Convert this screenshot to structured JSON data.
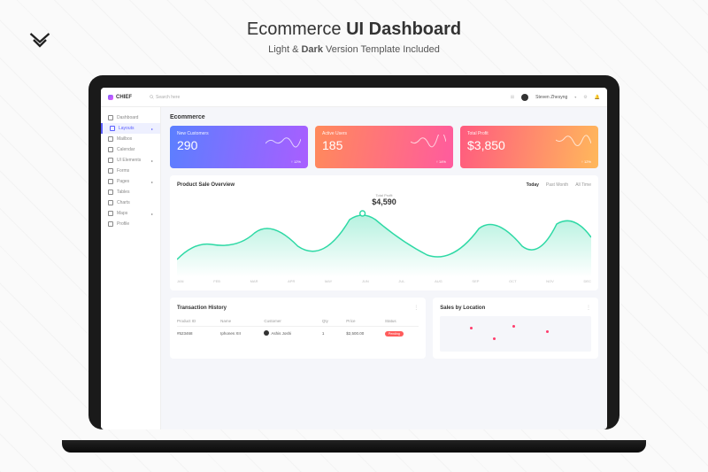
{
  "promo": {
    "title_light": "Ecommerce ",
    "title_bold": "UI Dashboard",
    "sub_a": "Light & ",
    "sub_b": "Dark",
    "sub_c": " Version Template Included"
  },
  "brand": "CHIEF",
  "search": {
    "placeholder": "Search here"
  },
  "user": {
    "name": "Steven Zhesyng"
  },
  "sidebar": {
    "items": [
      {
        "label": "Dashboard"
      },
      {
        "label": "Layouts"
      },
      {
        "label": "Mailbox"
      },
      {
        "label": "Calendar"
      },
      {
        "label": "UI Elements"
      },
      {
        "label": "Forms"
      },
      {
        "label": "Pages"
      },
      {
        "label": "Tables"
      },
      {
        "label": "Charts"
      },
      {
        "label": "Maps"
      },
      {
        "label": "Profile"
      }
    ]
  },
  "page": {
    "title": "Ecommerce"
  },
  "stats": [
    {
      "label": "New Customers",
      "value": "290",
      "trend": "12%"
    },
    {
      "label": "Active Users",
      "value": "185",
      "trend": "14%"
    },
    {
      "label": "Total Profit",
      "value": "$3,850",
      "trend": "12%"
    }
  ],
  "overview": {
    "title": "Product Sale Overview",
    "tabs": [
      "Today",
      "Past Month",
      "All Time"
    ],
    "total_label": "Total Profit",
    "total": "$4,590"
  },
  "chart_data": {
    "type": "area",
    "title": "Product Sale Overview",
    "xlabel": "",
    "ylabel": "",
    "categories": [
      "JAN",
      "FEB",
      "MAR",
      "APR",
      "MAY",
      "JUN",
      "JUL",
      "AUG",
      "SEP",
      "OCT",
      "NOV",
      "DEC"
    ],
    "values": [
      1200,
      2300,
      1800,
      3100,
      2200,
      4590,
      2800,
      1900,
      3400,
      2600,
      4100,
      3200
    ],
    "ylim": [
      0,
      5000
    ]
  },
  "transactions": {
    "title": "Transaction History",
    "columns": [
      "Product ID",
      "Name",
      "Customer",
      "Qty",
      "Price",
      "Status"
    ],
    "rows": [
      {
        "id": "#523468",
        "name": "Iphones XII",
        "customer": "Ashis Joshi",
        "qty": "1",
        "price": "$2,500.00",
        "status": "Pending"
      }
    ]
  },
  "location": {
    "title": "Sales by Location"
  }
}
